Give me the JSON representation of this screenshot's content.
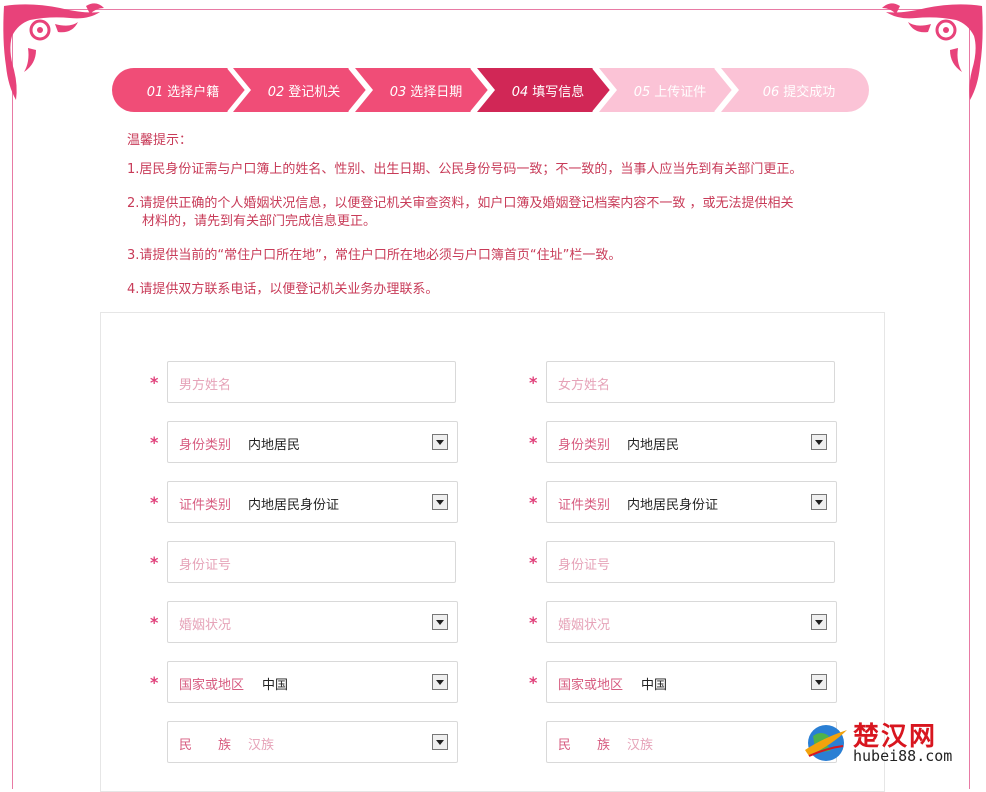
{
  "steps": [
    {
      "num": "01",
      "label": "选择户籍",
      "color": "#f04d77",
      "text_color": "#ffffff"
    },
    {
      "num": "02",
      "label": "登记机关",
      "color": "#f04d77",
      "text_color": "#ffffff"
    },
    {
      "num": "03",
      "label": "选择日期",
      "color": "#f04d77",
      "text_color": "#ffffff"
    },
    {
      "num": "04",
      "label": "填写信息",
      "color": "#d12756",
      "text_color": "#ffffff"
    },
    {
      "num": "05",
      "label": "上传证件",
      "color": "#fbc3d6",
      "text_color": "#ffffff"
    },
    {
      "num": "06",
      "label": "提交成功",
      "color": "#fbc3d6",
      "text_color": "#ffffff"
    }
  ],
  "notice": {
    "title": "温馨提示：",
    "items": [
      "1.居民身份证需与户口簿上的姓名、性别、出生日期、公民身份号码一致；不一致的，当事人应当先到有关部门更正。",
      "2.请提供正确的个人婚姻状况信息，以便登记机关审查资料，如户口簿及婚姻登记档案内容不一致 ，或无法提供相关",
      "材料的，请先到有关部门完成信息更正。",
      "3.请提供当前的“常住户口所在地”，常住户口所在地必须与户口簿首页“住址”栏一致。",
      "4.请提供双方联系电话，以便登记机关业务办理联系。"
    ]
  },
  "form": {
    "required_mark": "*",
    "male": {
      "name_placeholder": "男方姓名",
      "id_type_label": "身份类别",
      "id_type_value": "内地居民",
      "cert_type_label": "证件类别",
      "cert_type_value": "内地居民身份证",
      "id_no_placeholder": "身份证号",
      "marital_placeholder": "婚姻状况",
      "country_label": "国家或地区",
      "country_value": "中国",
      "ethnic_label": "民　　族",
      "ethnic_value": "汉族"
    },
    "female": {
      "name_placeholder": "女方姓名",
      "id_type_label": "身份类别",
      "id_type_value": "内地居民",
      "cert_type_label": "证件类别",
      "cert_type_value": "内地居民身份证",
      "id_no_placeholder": "身份证号",
      "marital_placeholder": "婚姻状况",
      "country_label": "国家或地区",
      "country_value": "中国",
      "ethnic_label": "民　　族",
      "ethnic_value": "汉族"
    }
  },
  "watermark": {
    "cn": "楚汉网",
    "en": "hubei88.com"
  },
  "colors": {
    "accent": "#f04d77",
    "active": "#d12756",
    "inactive": "#fbc3d6",
    "notice": "#c83b58",
    "border": "#e87aa4"
  }
}
